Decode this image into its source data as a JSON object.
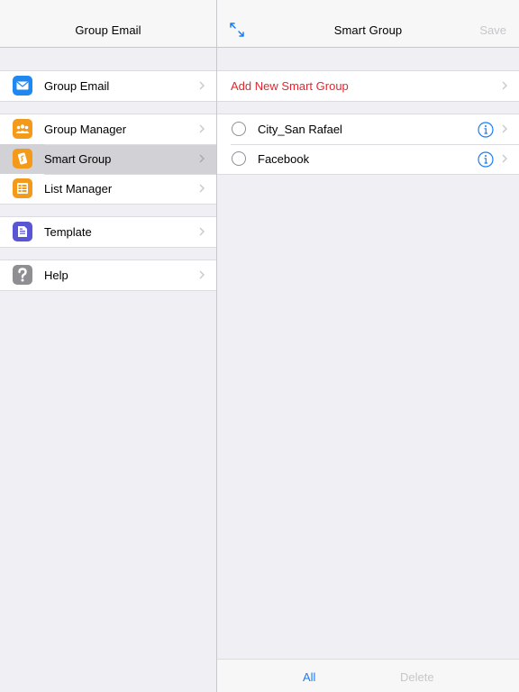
{
  "master": {
    "title": "Group Email",
    "sections": [
      {
        "items": [
          {
            "label": "Group Email",
            "icon": "envelope-icon",
            "color": "#1e88f0"
          }
        ]
      },
      {
        "items": [
          {
            "label": "Group Manager",
            "icon": "people-icon",
            "color": "#f49a1a"
          },
          {
            "label": "Smart Group",
            "icon": "smart-group-icon",
            "color": "#f49a1a",
            "selected": true
          },
          {
            "label": "List Manager",
            "icon": "list-icon",
            "color": "#f49a1a"
          }
        ]
      },
      {
        "items": [
          {
            "label": "Template",
            "icon": "template-icon",
            "color": "#5a55d3"
          }
        ]
      },
      {
        "items": [
          {
            "label": "Help",
            "icon": "question-icon",
            "color": "#8e8e93"
          }
        ]
      }
    ]
  },
  "detail": {
    "title": "Smart Group",
    "save_label": "Save",
    "add_label": "Add New Smart Group",
    "items": [
      {
        "label": "City_San Rafael"
      },
      {
        "label": "Facebook"
      }
    ],
    "toolbar": {
      "all_label": "All",
      "delete_label": "Delete"
    }
  },
  "colors": {
    "accent": "#1a7cf5",
    "add": "#e8242d",
    "disabled": "#c7c7cc"
  }
}
